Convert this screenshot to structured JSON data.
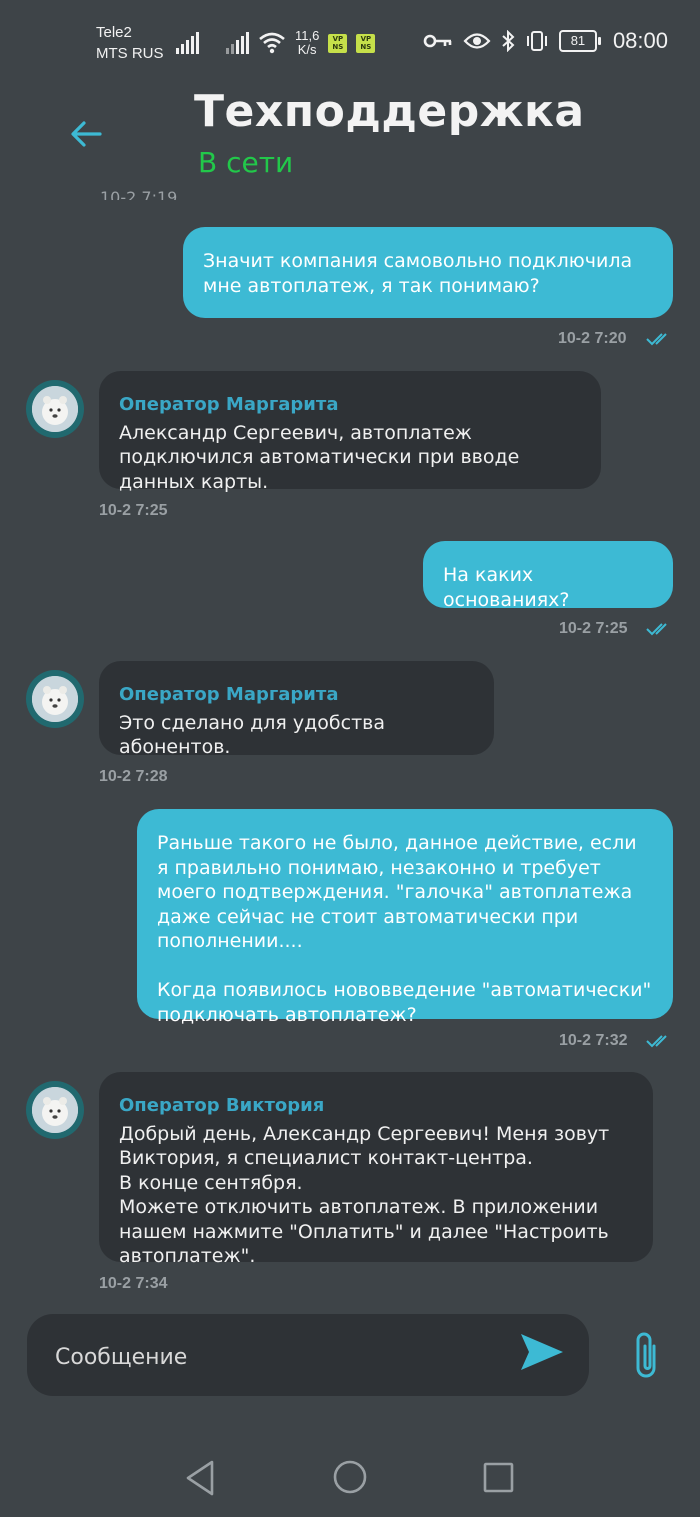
{
  "status_bar": {
    "carrier_1": "Tele2",
    "carrier_2": "MTS RUS",
    "speed_value": "11,6",
    "speed_unit": "K/s",
    "vpn_badge_1": "VP\nNS",
    "vpn_badge_2": "VP\nNS",
    "battery": "81",
    "time": "08:00"
  },
  "header": {
    "title": "Техподдержка",
    "status": "В сети"
  },
  "cut_timestamp": "10-2 7:19",
  "messages": [
    {
      "direction": "out",
      "text": "Значит компания самовольно подключила мне автоплатеж, я так понимаю?",
      "time": "10-2 7:20"
    },
    {
      "direction": "in",
      "sender": "Оператор Маргарита",
      "text": "Александр Сергеевич, автоплатеж подключился автоматически при вводе данных карты.",
      "time": "10-2 7:25"
    },
    {
      "direction": "out",
      "text": "На каких основаниях?",
      "time": "10-2 7:25"
    },
    {
      "direction": "in",
      "sender": "Оператор Маргарита",
      "text": "Это сделано для удобства абонентов.",
      "time": "10-2 7:28"
    },
    {
      "direction": "out",
      "text": "Раньше такого не было, данное действие, если я правильно понимаю, незаконно и требует моего подтверждения. \"галочка\" автоплатежа даже сейчас не стоит автоматически при пополнении....\n\nКогда появилось нововведение \"автоматически\" подключать автоплатеж?",
      "time": "10-2 7:32"
    },
    {
      "direction": "in",
      "sender": "Оператор Виктория",
      "text": "Добрый день, Александр Сергеевич! Меня зовут Виктория, я специалист контакт-центра.\n В конце сентября.\nМожете отключить автоплатеж. В приложении нашем нажмите \"Оплатить\" и далее \"Настроить автоплатеж\".",
      "time": "10-2 7:34"
    }
  ],
  "composer": {
    "placeholder": "Сообщение"
  },
  "colors": {
    "background": "#3e4448",
    "outgoing_bubble": "#3dbad4",
    "incoming_bubble": "#2e3236",
    "operator_name": "#3aa7c6",
    "online_status": "#22c84a",
    "accent": "#3dbad4"
  },
  "icons": {
    "back": "arrow-left-icon",
    "send": "send-icon",
    "attach": "paperclip-icon",
    "read": "double-check-icon",
    "nav_back": "triangle-back-icon",
    "nav_home": "circle-home-icon",
    "nav_recent": "square-recent-icon"
  }
}
